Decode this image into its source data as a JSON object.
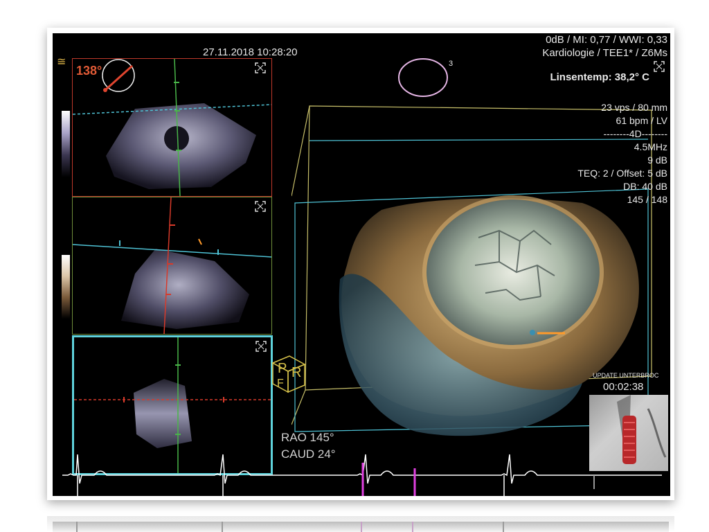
{
  "header": {
    "datetime": "27.11.2018 10:28:20",
    "line1": "0dB / MI: 0,77 / WWI: 0,33",
    "line2": "Kardiologie / TEE1* / Z6Ms",
    "temp": "Linsentemp: 38,2° C",
    "left_symbol": "≅"
  },
  "angle": {
    "value": "138°"
  },
  "orientation_badge": {
    "number": "3"
  },
  "params": [
    "23 vps / 80 mm",
    "61 bpm / LV",
    "--------4D--------",
    "4.5MHz",
    "9 dB",
    "TEQ: 2 / Offset: 5 dB",
    "DB: 40 dB",
    "145 / 148"
  ],
  "fluoro": {
    "label": "UPDATE UNTERBROC",
    "timer": "00:02:38"
  },
  "projection": {
    "line1": "RAO 145°",
    "line2": "CAUD 24°"
  },
  "orientation_cube": {
    "faces": [
      "P",
      "R",
      "F"
    ]
  },
  "colors": {
    "pane1_border": "#c0392b",
    "pane2_border": "#6f8f3b",
    "pane3_border": "#5fd3dc",
    "cyan_line": "#4fc3d6",
    "green_line": "#49b649",
    "red_line": "#d83a2a",
    "ecg": "#ffffff",
    "marker": "#e040e0",
    "tissue": "#c9a46a"
  },
  "icons": {
    "expand": "expand-icon",
    "angle_dial": "angle-dial-icon",
    "orientation": "orientation-ring-icon",
    "cube": "orientation-cube-icon"
  }
}
